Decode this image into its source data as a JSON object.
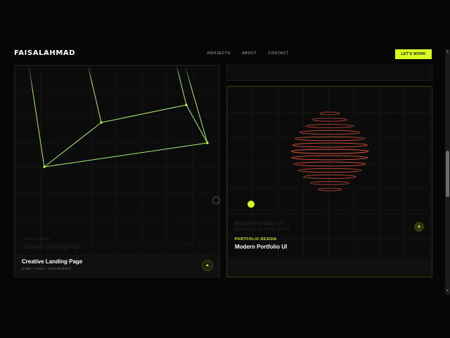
{
  "header": {
    "logo": "FAISALAHMAD",
    "nav": [
      "PROJECTS",
      "ABOUT",
      "CONTACT"
    ],
    "cta_label": "LET'S WORK"
  },
  "projects": [
    {
      "ghost_tag": "WEB DESIGN",
      "ghost_title": "Creative Landing Page",
      "title": "Creative Landing Page",
      "subtitle": "HTML • CSS • JAVASCRIPT",
      "arrow_icon": "arrow-icon"
    },
    {
      "ghost_title": "Modern Portfolio UI",
      "ghost_tag": "INTERACTIVE EXPERIENCE",
      "tag": "PORTFOLIO DESIGN",
      "title": "Modern Portfolio UI",
      "arrow_icon": "arrow-icon"
    }
  ],
  "colors": {
    "accent": "#d6ff1f",
    "line": "#a8f07a",
    "sphere": "#e0553a"
  },
  "sphere_rings": [
    0.25,
    0.45,
    0.62,
    0.78,
    0.9,
    0.97,
    1.0,
    0.99,
    0.93,
    0.82,
    0.68,
    0.5,
    0.3
  ]
}
